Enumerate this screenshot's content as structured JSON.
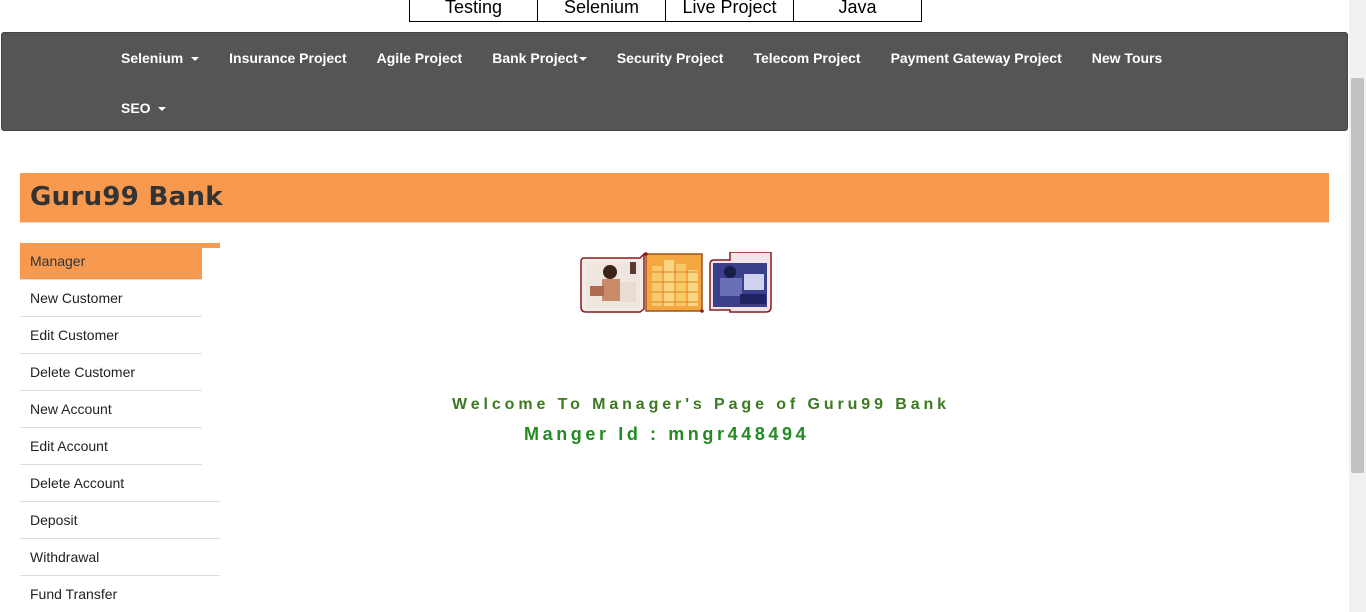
{
  "top_tabs": [
    "Testing",
    "Selenium",
    "Live Project",
    "Java"
  ],
  "navbar": {
    "row1": [
      {
        "label": "Selenium",
        "dropdown": true,
        "spaced_caret": true
      },
      {
        "label": "Insurance Project",
        "dropdown": false
      },
      {
        "label": "Agile Project",
        "dropdown": false
      },
      {
        "label": "Bank Project",
        "dropdown": true,
        "spaced_caret": false
      },
      {
        "label": "Security Project",
        "dropdown": false
      },
      {
        "label": "Telecom Project",
        "dropdown": false
      },
      {
        "label": "Payment Gateway Project",
        "dropdown": false
      },
      {
        "label": "New Tours",
        "dropdown": false
      }
    ],
    "row2": [
      {
        "label": "SEO",
        "dropdown": true,
        "spaced_caret": true
      }
    ],
    "background": "#555555"
  },
  "bank": {
    "title": "Guru99 Bank",
    "accent": "#f79a50"
  },
  "sidebar": {
    "items": [
      "Manager",
      "New Customer",
      "Edit Customer",
      "Delete Customer",
      "New Account",
      "Edit Account",
      "Delete Account",
      "Deposit",
      "Withdrawal",
      "Fund Transfer"
    ],
    "active": "Manager"
  },
  "main": {
    "welcome": "Welcome To Manager's Page of Guru99 Bank",
    "manager_id": "Manger Id : mngr448494",
    "welcome_color": "#3b7a21",
    "manager_id_color": "#228b22"
  }
}
